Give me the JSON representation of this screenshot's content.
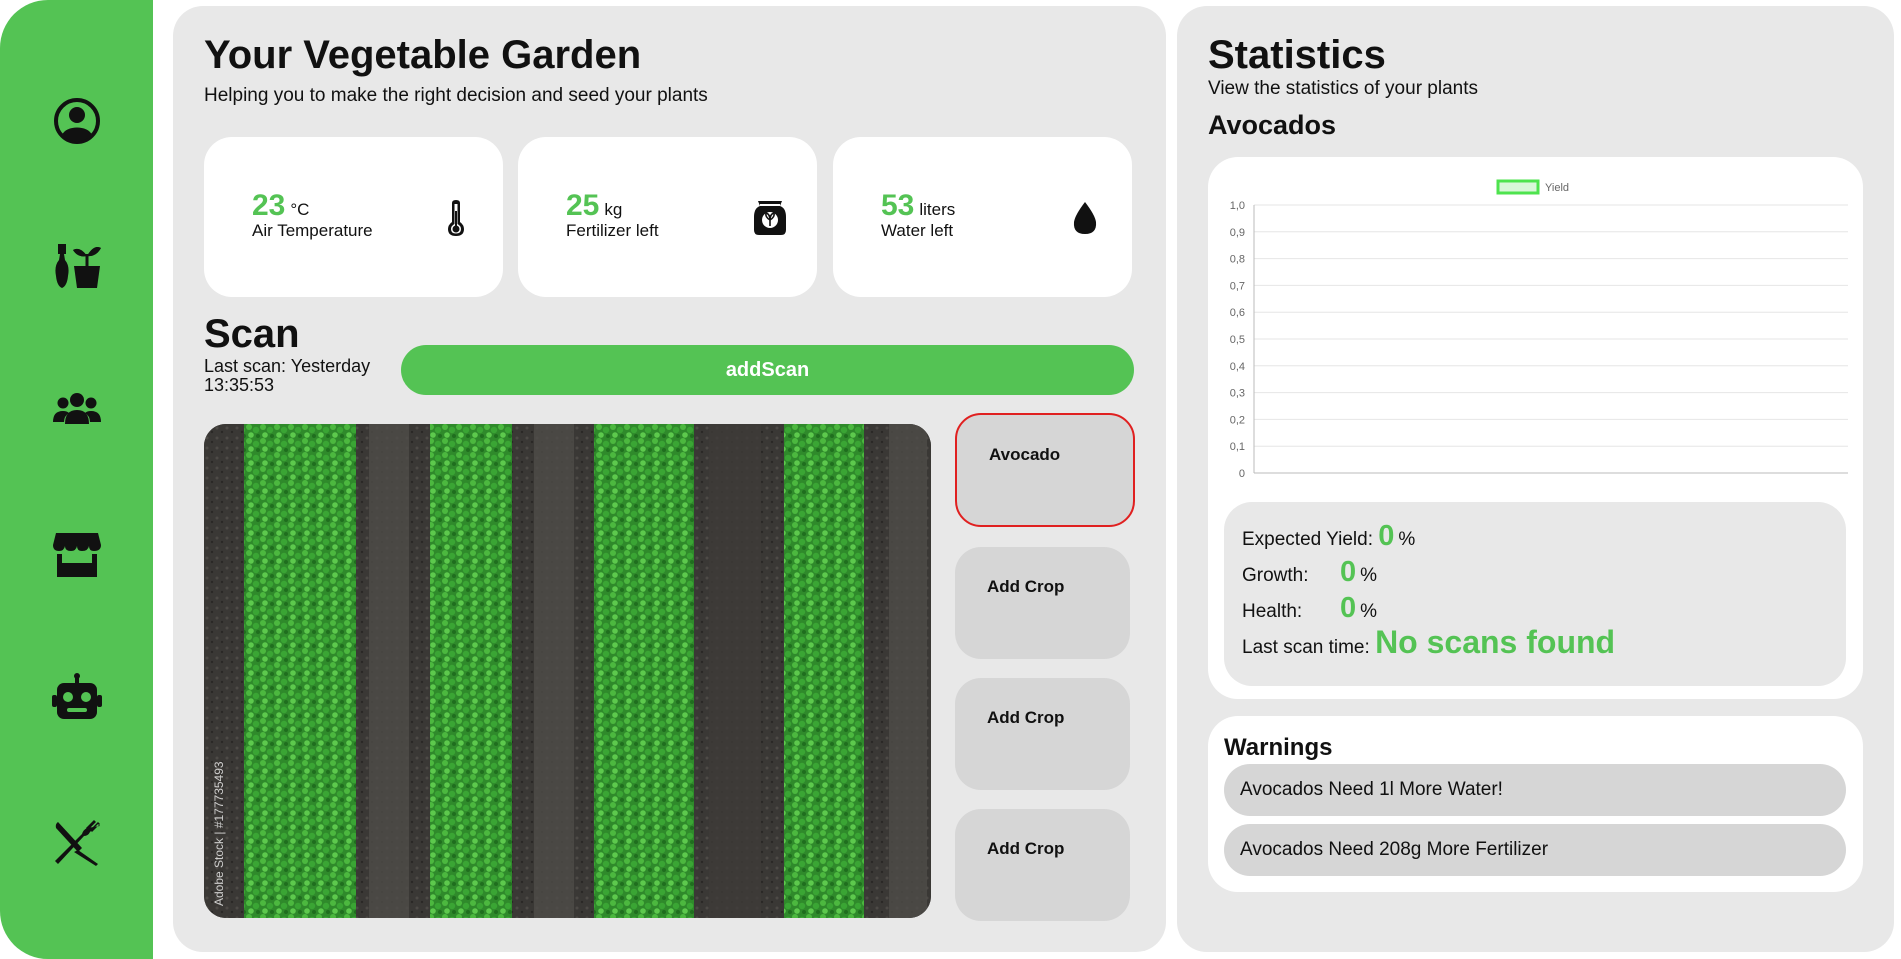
{
  "sidebar": {
    "items": [
      {
        "name": "profile",
        "icon": "user-circle-icon"
      },
      {
        "name": "plants",
        "icon": "gardening-tools-icon"
      },
      {
        "name": "community",
        "icon": "users-icon"
      },
      {
        "name": "store",
        "icon": "store-icon"
      },
      {
        "name": "robot",
        "icon": "robot-icon"
      },
      {
        "name": "recipes",
        "icon": "fork-knife-icon"
      }
    ]
  },
  "garden": {
    "title": "Your Vegetable Garden",
    "subtitle": "Helping you to make the right decision and seed your plants",
    "metrics": [
      {
        "value": "23",
        "unit": "°C",
        "label": "Air Temperature",
        "icon": "thermometer-icon"
      },
      {
        "value": "25",
        "unit": "kg",
        "label": "Fertilizer left",
        "icon": "fertilizer-bag-icon"
      },
      {
        "value": "53",
        "unit": "liters",
        "label": "Water left",
        "icon": "water-drop-icon"
      }
    ]
  },
  "scan": {
    "title": "Scan",
    "last_scan": "Last scan: Yesterday 13:35:53",
    "button_label": "addScan",
    "image_watermark": "Adobe Stock | #177735493"
  },
  "crops": [
    {
      "label": "Avocado",
      "selected": true
    },
    {
      "label": "Add Crop",
      "selected": false
    },
    {
      "label": "Add Crop",
      "selected": false
    },
    {
      "label": "Add Crop",
      "selected": false
    }
  ],
  "statistics": {
    "title": "Statistics",
    "subtitle": "View the statistics of your plants",
    "plant_name": "Avocados",
    "expected_yield_label": "Expected Yield:",
    "expected_yield_value": "0",
    "growth_label": "Growth:",
    "growth_value": "0",
    "health_label": "Health:",
    "health_value": "0",
    "percent": "%",
    "last_scan_label": "Last scan time:",
    "last_scan_value": "No scans found"
  },
  "chart_data": {
    "type": "line",
    "series": [
      {
        "name": "Yield",
        "values": []
      }
    ],
    "categories": [],
    "yticks": [
      "1,0",
      "0,9",
      "0,8",
      "0,7",
      "0,6",
      "0,5",
      "0,4",
      "0,3",
      "0,2",
      "0,1",
      "0"
    ],
    "ylim": [
      0,
      1
    ],
    "grid": true,
    "legend": "top",
    "colors": {
      "series_border": "#4ee34e",
      "series_fill": "#d9f7d9"
    }
  },
  "warnings": {
    "title": "Warnings",
    "items": [
      "Avocados Need 1l More Water!",
      "Avocados Need 208g More Fertilizer"
    ]
  },
  "colors": {
    "accent": "#54c354",
    "panel": "#e8e8e8",
    "card": "#ffffff",
    "pill": "#d6d6d6",
    "selected_border": "#e02020"
  }
}
